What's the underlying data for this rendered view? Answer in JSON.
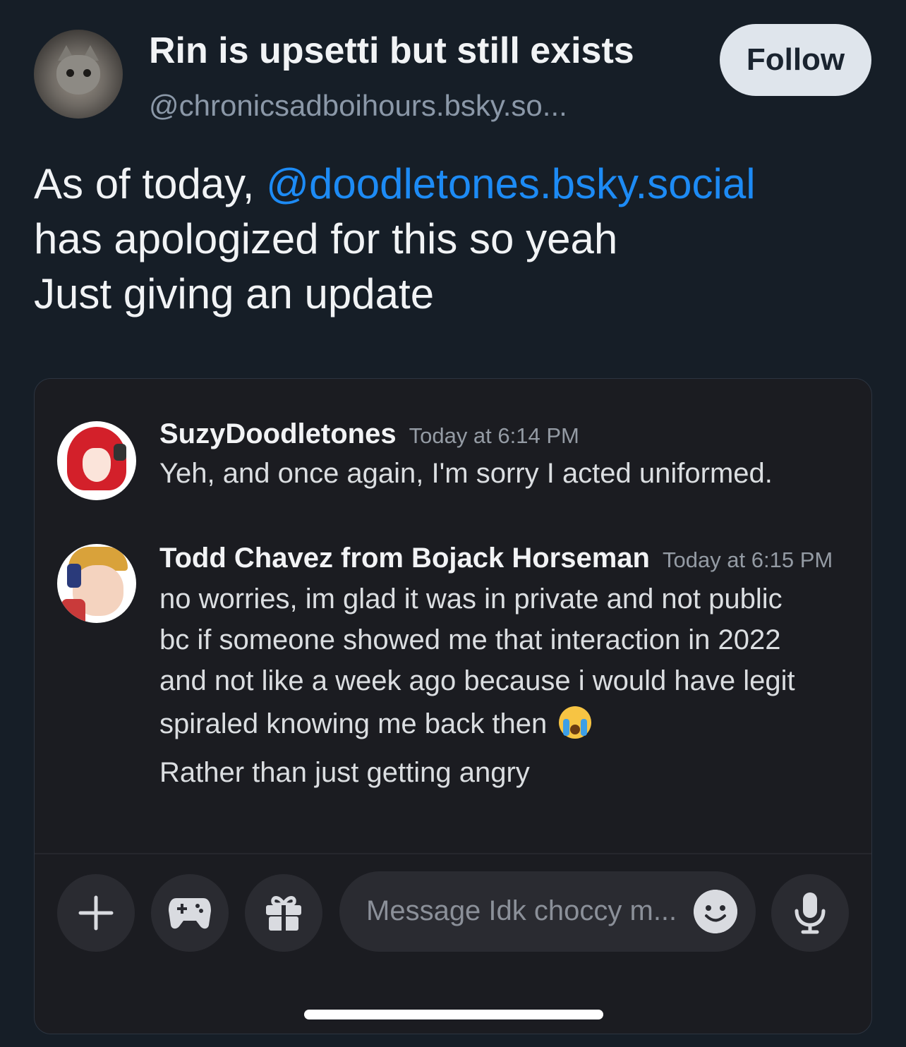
{
  "post": {
    "author": {
      "display_name": "Rin is upsetti but still exists",
      "handle": "@chronicsadboihours.bsky.so..."
    },
    "follow_label": "Follow",
    "text": {
      "line1_prefix": "As of today, ",
      "mention": "@doodletones.bsky.social",
      "line2": "has apologized for this so yeah",
      "line3": "Just giving an update"
    }
  },
  "embed": {
    "messages": [
      {
        "author": "SuzyDoodletones",
        "time": "Today at 6:14 PM",
        "lines": [
          "Yeh, and once again, I'm sorry I acted uniformed."
        ]
      },
      {
        "author": "Todd Chavez from Bojack Horseman",
        "time": "Today at 6:15 PM",
        "lines": [
          "no worries, im glad it was in private and not public",
          "bc if someone showed me that interaction in 2022",
          "and not like a week ago because i would have legit",
          "spiraled knowing me back then",
          "Rather than just getting angry"
        ],
        "emoji": "loudly-crying-face"
      }
    ],
    "composer": {
      "placeholder": "Message Idk choccy m...",
      "icons": [
        "plus-icon",
        "gamepad-icon",
        "gift-icon",
        "emoji-icon",
        "microphone-icon"
      ]
    }
  },
  "colors": {
    "background": "#161e27",
    "mention": "#1d8bf5",
    "embed_bg": "#1b1c21",
    "button_bg": "#2a2b31"
  }
}
